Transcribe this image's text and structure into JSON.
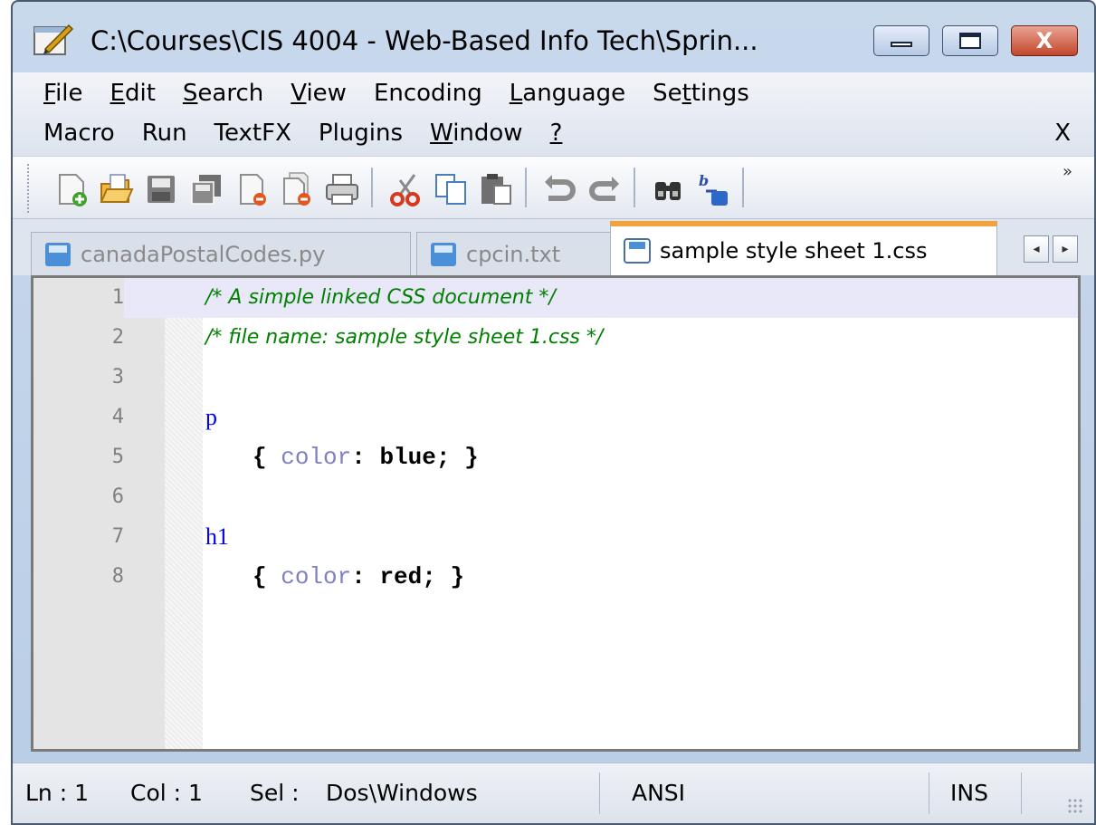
{
  "window": {
    "title": "C:\\Courses\\CIS 4004 - Web-Based Info Tech\\Sprin...",
    "buttons": {
      "minimize": "minimize",
      "maximize": "maximize",
      "close": "X"
    }
  },
  "menu": {
    "row1": [
      {
        "label": "File",
        "accel": "F",
        "rest": "ile"
      },
      {
        "label": "Edit",
        "accel": "E",
        "rest": "dit"
      },
      {
        "label": "Search",
        "accel": "S",
        "rest": "earch"
      },
      {
        "label": "View",
        "accel": "V",
        "rest": "iew"
      },
      {
        "label": "Encoding",
        "accel": "",
        "rest": "Encoding"
      },
      {
        "label": "Language",
        "accel": "L",
        "rest": "anguage"
      },
      {
        "label": "Settings",
        "pre": "Se",
        "accel": "t",
        "rest": "tings"
      }
    ],
    "row2": [
      {
        "label": "Macro"
      },
      {
        "label": "Run"
      },
      {
        "label": "TextFX"
      },
      {
        "label": "Plugins"
      },
      {
        "label": "Window",
        "accel": "W",
        "rest": "indow"
      },
      {
        "label": "?",
        "accel": "?",
        "rest": ""
      }
    ],
    "close_label": "X"
  },
  "toolbar": {
    "icons": [
      "new-file-icon",
      "open-file-icon",
      "save-icon",
      "save-all-icon",
      "close-icon",
      "close-all-icon",
      "print-icon",
      "cut-icon",
      "copy-icon",
      "paste-icon",
      "undo-icon",
      "redo-icon",
      "find-icon",
      "replace-icon"
    ],
    "overflow": "»"
  },
  "tabs": [
    {
      "label": "canadaPostalCodes.py",
      "active": false
    },
    {
      "label": "cpcin.txt",
      "active": false
    },
    {
      "label": "sample style sheet 1.css",
      "active": true
    }
  ],
  "tab_scroll": {
    "left": "◂",
    "right": "▸"
  },
  "editor": {
    "lines": [
      {
        "num": "1",
        "comment": "/* A simple linked CSS document */"
      },
      {
        "num": "2",
        "comment": "/* file name: sample style sheet 1.css */"
      },
      {
        "num": "3"
      },
      {
        "num": "4",
        "selector": "p"
      },
      {
        "num": "5",
        "open": "{",
        "prop": "color",
        "colon": ":",
        "value": "blue",
        "semi": ";",
        "close": "}"
      },
      {
        "num": "6"
      },
      {
        "num": "7",
        "selector": "h1"
      },
      {
        "num": "8",
        "open": "{",
        "prop": "color",
        "colon": ":",
        "value": "red",
        "semi": ";",
        "close": "}"
      }
    ],
    "current_line": 1
  },
  "status": {
    "ln": "Ln : 1",
    "col": "Col : 1",
    "sel": "Sel :",
    "eol": "Dos\\Windows",
    "encoding": "ANSI",
    "mode": "INS"
  },
  "colors": {
    "comment": "#008000",
    "selector": "#0000ff",
    "property": "#8080c0",
    "active_tab_accent": "#f2a33c",
    "close_button": "#c3462c"
  }
}
